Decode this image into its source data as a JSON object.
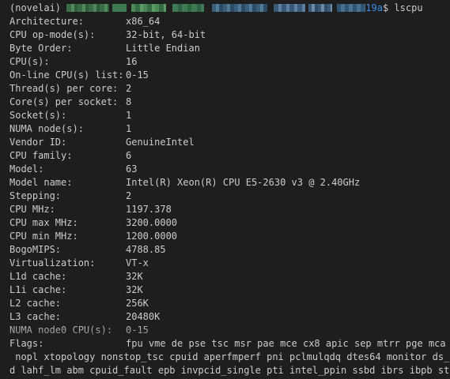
{
  "prompt": {
    "env": "(novelai)",
    "host_suffix": "19a",
    "symbol": "$",
    "command": "lscpu"
  },
  "rows": [
    {
      "key": "Architecture:",
      "value": "x86_64"
    },
    {
      "key": "CPU op-mode(s):",
      "value": "32-bit, 64-bit"
    },
    {
      "key": "Byte Order:",
      "value": "Little Endian"
    },
    {
      "key": "CPU(s):",
      "value": "16"
    },
    {
      "key": "On-line CPU(s) list:",
      "value": "0-15"
    },
    {
      "key": "Thread(s) per core:",
      "value": "2"
    },
    {
      "key": "Core(s) per socket:",
      "value": "8"
    },
    {
      "key": "Socket(s):",
      "value": "1"
    },
    {
      "key": "NUMA node(s):",
      "value": "1"
    },
    {
      "key": "Vendor ID:",
      "value": "GenuineIntel"
    },
    {
      "key": "CPU family:",
      "value": "6"
    },
    {
      "key": "Model:",
      "value": "63"
    },
    {
      "key": "Model name:",
      "value": "Intel(R) Xeon(R) CPU E5-2630 v3 @ 2.40GHz"
    },
    {
      "key": "Stepping:",
      "value": "2"
    },
    {
      "key": "CPU MHz:",
      "value": "1197.378"
    },
    {
      "key": "CPU max MHz:",
      "value": "3200.0000"
    },
    {
      "key": "CPU min MHz:",
      "value": "1200.0000"
    },
    {
      "key": "BogoMIPS:",
      "value": "4788.85"
    },
    {
      "key": "Virtualization:",
      "value": "VT-x"
    },
    {
      "key": "L1d cache:",
      "value": "32K"
    },
    {
      "key": "L1i cache:",
      "value": "32K"
    },
    {
      "key": "L2 cache:",
      "value": "256K"
    },
    {
      "key": "L3 cache:",
      "value": "20480K"
    },
    {
      "key": "NUMA node0 CPU(s):",
      "value": "0-15"
    },
    {
      "key": "Flags:",
      "value": "fpu vme de pse tsc msr pae mce cx8 apic sep mtrr pge mca cm"
    }
  ],
  "flags_continuation": [
    " nopl xtopology nonstop_tsc cpuid aperfmperf pni pclmulqdq dtes64 monitor ds_cpl",
    "d lahf_lm abm cpuid_fault epb invpcid_single pti intel_ppin ssbd ibrs ibpb stibp"
  ],
  "colors": {
    "background": "#1e1e1e",
    "foreground": "#cccccc",
    "host": "#3b8eea"
  }
}
